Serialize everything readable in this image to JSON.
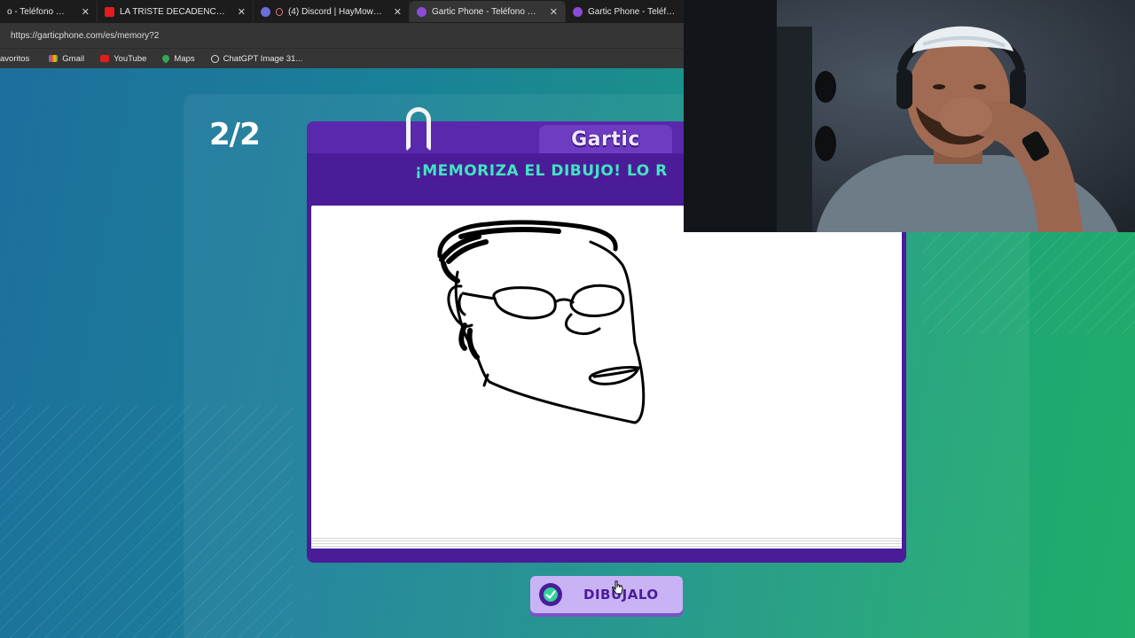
{
  "browser": {
    "tabs": [
      {
        "label": "o - Teléfono Descomp",
        "favicon": "gartic-icon",
        "active": false
      },
      {
        "label": "LA TRISTE DECADENCIA DE KICK",
        "favicon": "youtube-icon",
        "active": false
      },
      {
        "label": "(4) Discord | HayMower, sop",
        "favicon": "discord-icon",
        "active": false
      },
      {
        "label": "Gartic Phone - Teléfono Descomp",
        "favicon": "gartic-icon",
        "active": true
      },
      {
        "label": "Gartic Phone - Teléfono De",
        "favicon": "gartic-icon",
        "active": false
      }
    ],
    "url": "https://garticphone.com/es/memory?2",
    "bookmarks": [
      {
        "label": "avoritos",
        "icon": "folder-icon"
      },
      {
        "label": "Gmail",
        "icon": "gmail-icon"
      },
      {
        "label": "YouTube",
        "icon": "youtube-icon"
      },
      {
        "label": "Maps",
        "icon": "maps-icon"
      },
      {
        "label": "ChatGPT Image 31...",
        "icon": "globe-icon"
      }
    ]
  },
  "game": {
    "round": "2/2",
    "logo": "Gartic",
    "instruction": "¡MEMORIZA EL DIBUJO! LO R",
    "button_label": "DIBÚJALO",
    "colors": {
      "header_purple": "#4b1c98",
      "instruction_teal": "#3fe6c0",
      "button_lilac": "#c9b3f5"
    }
  }
}
